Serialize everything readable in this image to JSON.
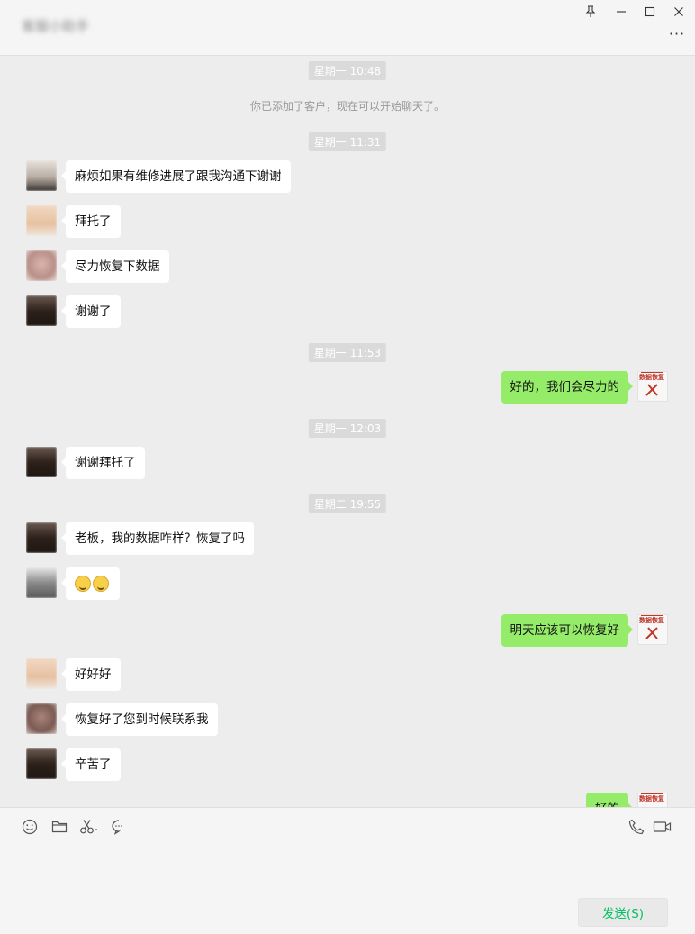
{
  "window": {
    "title": "客服小助手",
    "pin_icon": "pin-icon",
    "minimize_icon": "minimize-icon",
    "maximize_icon": "maximize-icon",
    "close_icon": "close-icon",
    "more_label": "···"
  },
  "chat": {
    "timestamps": [
      "星期一 10:48",
      "星期一 11:31",
      "星期一 11:53",
      "星期一 12:03",
      "星期二 19:55"
    ],
    "system_note": "你已添加了客户，现在可以开始聊天了。",
    "messages": [
      {
        "side": "in",
        "text": "麻烦如果有维修进展了跟我沟通下谢谢",
        "avatar_color": "#c9c0b6"
      },
      {
        "side": "in",
        "text": "拜托了",
        "avatar_color": "#e8c7a8"
      },
      {
        "side": "in",
        "text": "尽力恢复下数据",
        "avatar_color": "#c9a7a0"
      },
      {
        "side": "in",
        "text": "谢谢了",
        "avatar_color": "#3a2a22"
      },
      {
        "side": "out",
        "text": "好的，我们会尽力的"
      },
      {
        "side": "in",
        "text": "谢谢拜托了",
        "avatar_color": "#3a2a22"
      },
      {
        "side": "in",
        "text": "老板，我的数据咋样？恢复了吗",
        "avatar_color": "#3a2a22"
      },
      {
        "side": "in",
        "text": "",
        "emoji_count": 2,
        "avatar_color": "#6b6b6b"
      },
      {
        "side": "out",
        "text": "明天应该可以恢复好"
      },
      {
        "side": "in",
        "text": "好好好",
        "avatar_color": "#e8c7a8"
      },
      {
        "side": "in",
        "text": "恢复好了您到时候联系我",
        "avatar_color": "#8a6a62"
      },
      {
        "side": "in",
        "text": "辛苦了",
        "avatar_color": "#3a2a22"
      },
      {
        "side": "out",
        "text": "好的"
      }
    ],
    "logo_label": "数据恢复"
  },
  "toolbar": {
    "icons": [
      "emoji-icon",
      "folder-icon",
      "scissors-icon",
      "chat-history-icon",
      "phone-icon",
      "video-icon"
    ],
    "send_label": "发送(S)"
  },
  "colors": {
    "chat_bg": "#ededed",
    "bubble_out": "#95ec69",
    "bubble_in": "#ffffff",
    "send_text": "#07c160"
  }
}
